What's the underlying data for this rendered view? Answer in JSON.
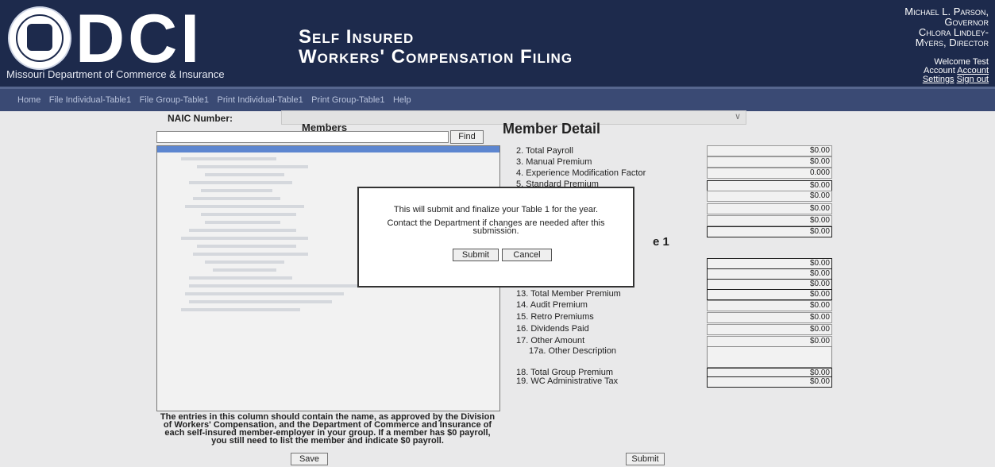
{
  "header": {
    "logo_text": "DCI",
    "org_name": "Missouri Department of Commerce & Insurance",
    "title_line1": "Self Insured",
    "title_line2": "Workers' Compensation Filing",
    "officials": [
      "Michael L. Parson,",
      "Governor",
      "Chlora Lindley-",
      "Myers, Director"
    ],
    "welcome": "Welcome Test",
    "account_prefix": "Account",
    "account_link": "Account",
    "settings_link": "Settings",
    "signout_link": "Sign out"
  },
  "nav": {
    "items": [
      "Home",
      "File Individual-Table1",
      "File Group-Table1",
      "Print Individual-Table1",
      "Print Group-Table1",
      "Help"
    ]
  },
  "filters": {
    "naic_label": "NAIC Number:"
  },
  "members": {
    "heading": "Members",
    "find_label": "Find",
    "note": "The entries in this column should contain the name, as approved by the Division of Workers' Compensation, and the Department of Commerce and Insurance of each self-insured member-employer in your group. If a member has $0 payroll, you still need to list the member and indicate $0 payroll.",
    "save_label": "Save"
  },
  "detail": {
    "title": "Member Detail",
    "fields": [
      {
        "label": "2. Total Payroll",
        "value": "$0.00"
      },
      {
        "label": "3. Manual Premium",
        "value": "$0.00"
      },
      {
        "label": "4. Experience Modification Factor",
        "value": "0.000"
      },
      {
        "label": "5. Standard Premium",
        "value": "$0.00"
      },
      {
        "label": "",
        "value": "$0.00"
      },
      {
        "label": "",
        "value": "$0.00"
      },
      {
        "label": "",
        "value": "$0.00"
      },
      {
        "label": "",
        "value": "$0.00"
      },
      {
        "label": "",
        "value": "$0.00"
      },
      {
        "label": "",
        "value": "$0.00"
      },
      {
        "label": "",
        "value": "$0.00"
      },
      {
        "label": "13. Total Member Premium",
        "value": "$0.00"
      },
      {
        "label": "14. Audit Premium",
        "value": "$0.00"
      },
      {
        "label": "15. Retro Premiums",
        "value": "$0.00"
      },
      {
        "label": "16. Dividends Paid",
        "value": "$0.00"
      },
      {
        "label": "17. Other Amount",
        "value": "$0.00"
      },
      {
        "label": "17a. Other Description",
        "value": ""
      },
      {
        "label": "18. Total Group Premium",
        "value": "$0.00"
      },
      {
        "label": "19. WC Administrative Tax",
        "value": "$0.00"
      }
    ],
    "bg_fragment": "e 1",
    "submit_label": "Submit"
  },
  "dialog": {
    "message1": "This will submit and finalize your Table 1 for the year.",
    "message2": "Contact the Department if changes are needed after this submission.",
    "submit_label": "Submit",
    "cancel_label": "Cancel"
  }
}
